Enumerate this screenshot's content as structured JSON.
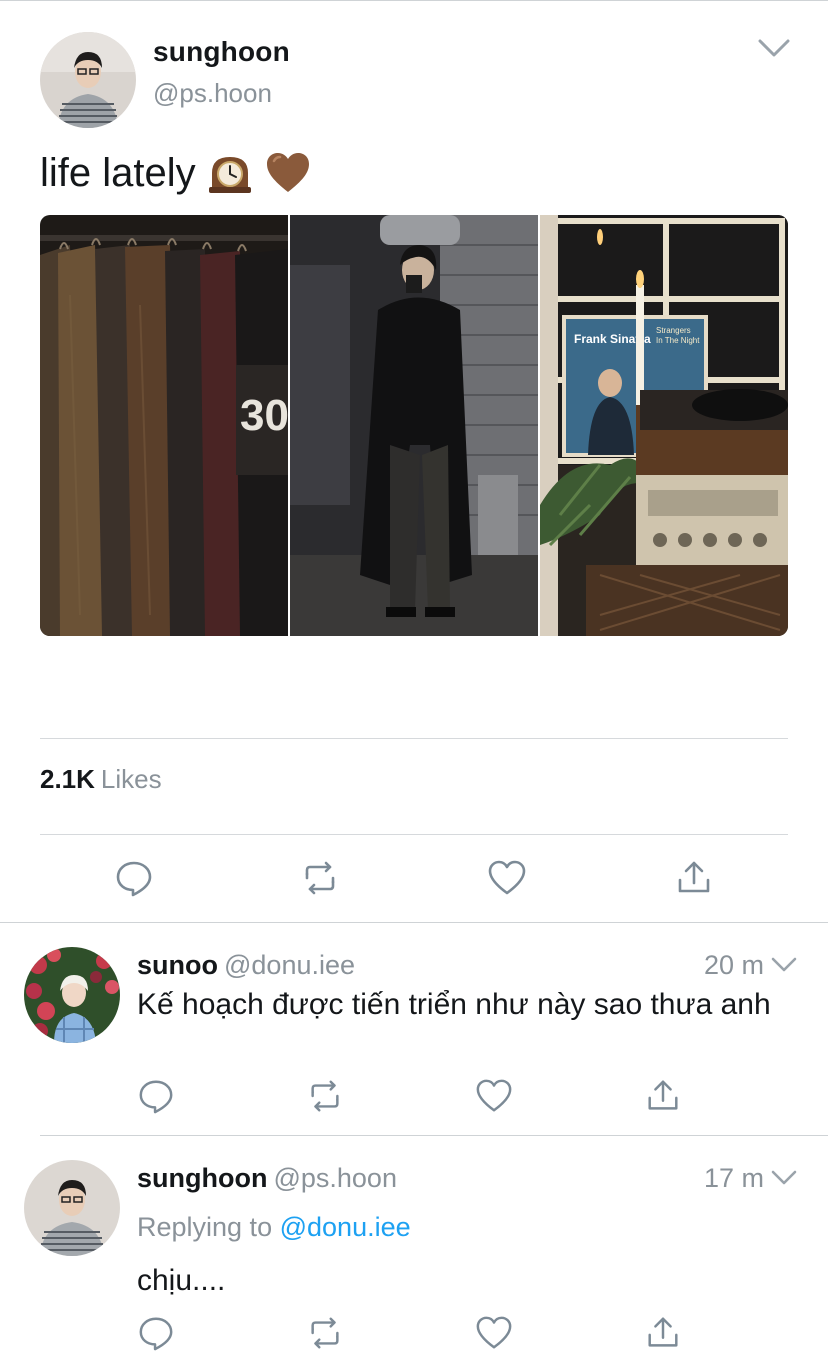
{
  "tweet": {
    "display_name": "sunghoon",
    "handle": "@ps.hoon",
    "text": "life lately",
    "emojis": [
      "mantelpiece-clock-icon",
      "brown-heart-icon"
    ],
    "likes_count": "2.1K",
    "likes_label": "Likes"
  },
  "replies": [
    {
      "display_name": "sunoo",
      "handle": "@donu.iee",
      "time": "20 m",
      "text": "Kế hoạch được tiến triển như này sao thưa anh"
    },
    {
      "display_name": "sunghoon",
      "handle": "@ps.hoon",
      "time": "17 m",
      "replying_prefix": "Replying to",
      "replying_to": "@donu.iee",
      "text": "chịu...."
    }
  ],
  "colors": {
    "accent": "#1da1f2",
    "secondary_text": "#8a9299",
    "icon": "#7c8a96"
  }
}
